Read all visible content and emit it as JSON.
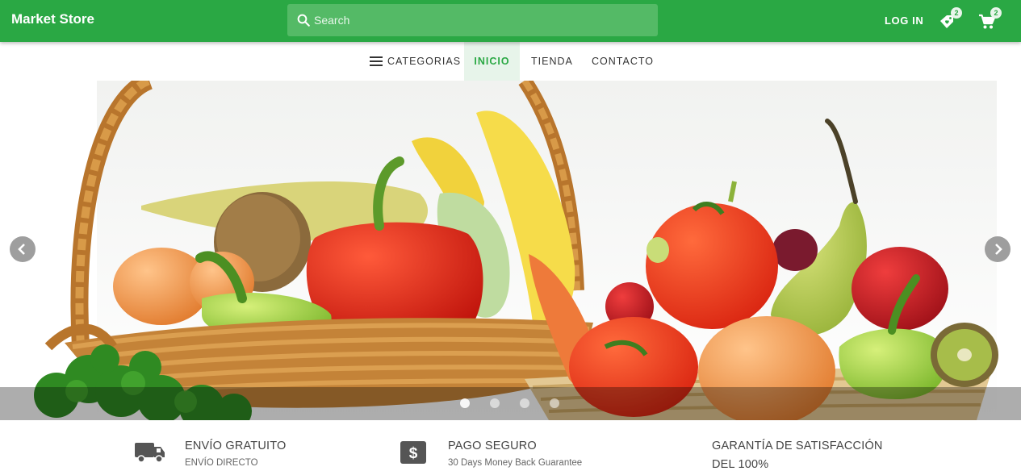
{
  "header": {
    "brand": "Market Store",
    "search_placeholder": "Search",
    "login_label": "LOG IN",
    "wishlist_count": "2",
    "cart_count": "2",
    "accent_color": "#2aa844"
  },
  "nav": {
    "categories_label": "CATEGORIAS",
    "items": [
      {
        "label": "INICIO",
        "active": true
      },
      {
        "label": "TIENDA",
        "active": false
      },
      {
        "label": "CONTACTO",
        "active": false
      }
    ]
  },
  "carousel": {
    "slide_count": 4,
    "active_index": 0,
    "icons": {
      "prev": "chevron-left-icon",
      "next": "chevron-right-icon"
    }
  },
  "features": [
    {
      "icon": "truck-icon",
      "title": "ENVÍO GRATUITO",
      "subtitle": "ENVÍO DIRECTO"
    },
    {
      "icon": "dollar-icon",
      "title": "PAGO SEGURO",
      "subtitle": "30 Days Money Back Guarantee"
    },
    {
      "icon": "",
      "title": "GARANTÍA DE SATISFACCIÓN",
      "subtitle": "DEL 100%"
    }
  ]
}
